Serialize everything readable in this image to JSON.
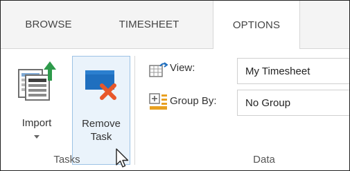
{
  "tabs": [
    {
      "label": "BROWSE",
      "active": false
    },
    {
      "label": "TIMESHEET",
      "active": false
    },
    {
      "label": "OPTIONS",
      "active": true
    }
  ],
  "ribbon": {
    "tasks_group": {
      "label": "Tasks",
      "import": {
        "label": "Import",
        "icon": "import-icon"
      },
      "remove": {
        "line1": "Remove",
        "line2": "Task",
        "icon": "remove-task-icon"
      }
    },
    "data_group": {
      "label": "Data",
      "view": {
        "label": "View:",
        "value": "My Timesheet",
        "icon": "view-icon"
      },
      "group_by": {
        "label": "Group By:",
        "value": "No Group",
        "icon": "group-by-icon"
      }
    }
  },
  "colors": {
    "tabstrip_bg": "#f4f4f4",
    "hover_border": "#9cc2e5",
    "hover_bg": "#eaf3fb",
    "accent_green": "#2e9a4b",
    "accent_blue": "#1f6fbf",
    "remove_x_orange": "#e8572a"
  }
}
